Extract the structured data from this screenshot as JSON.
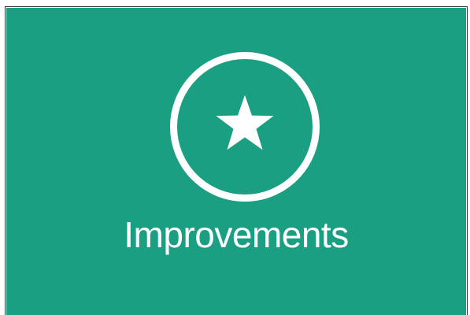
{
  "tile": {
    "label": "Improvements",
    "icon": "star-in-circle-icon",
    "background_color": "#1a9f82",
    "foreground_color": "#ffffff"
  }
}
